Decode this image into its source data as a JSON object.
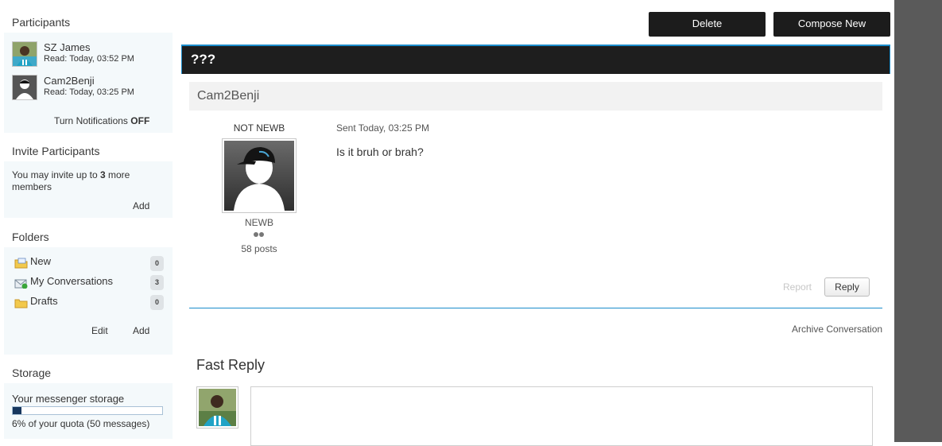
{
  "sidebar": {
    "participants": {
      "title": "Participants",
      "people": [
        {
          "name": "SZ James",
          "read": "Read: Today, 03:52 PM"
        },
        {
          "name": "Cam2Benji",
          "read": "Read: Today, 03:25 PM"
        }
      ],
      "notifications_prefix": "Turn Notifications",
      "notifications_state": "OFF"
    },
    "invite": {
      "title": "Invite Participants",
      "text_prefix": "You may invite up to",
      "count": "3",
      "text_suffix": "more",
      "text_line2": "members",
      "add_label": "Add"
    },
    "folders": {
      "title": "Folders",
      "items": [
        {
          "label": "New",
          "count": "0"
        },
        {
          "label": "My Conversations",
          "count": "3"
        },
        {
          "label": "Drafts",
          "count": "0"
        }
      ],
      "edit_label": "Edit",
      "add_label": "Add"
    },
    "storage": {
      "title": "Storage",
      "label": "Your messenger storage",
      "usage_fraction": 0.06,
      "usage_text": "6% of your quota (50 messages)"
    }
  },
  "toolbar": {
    "delete_label": "Delete",
    "compose_label": "Compose New"
  },
  "conversation": {
    "title": "???",
    "message": {
      "author": "Cam2Benji",
      "user_title": "NOT NEWB",
      "rank": "NEWB",
      "posts": "58 posts",
      "sent": "Sent Today, 03:25 PM",
      "body": "Is it bruh or brah?",
      "report_label": "Report",
      "reply_label": "Reply"
    },
    "archive_label": "Archive Conversation"
  },
  "fast_reply": {
    "title": "Fast Reply",
    "text": ""
  },
  "colors": {
    "accent": "#1a8ccb",
    "dark_button": "#1c1c1c",
    "sidebar_bg": "#f4f9fb",
    "storage_fill": "#17375e"
  }
}
